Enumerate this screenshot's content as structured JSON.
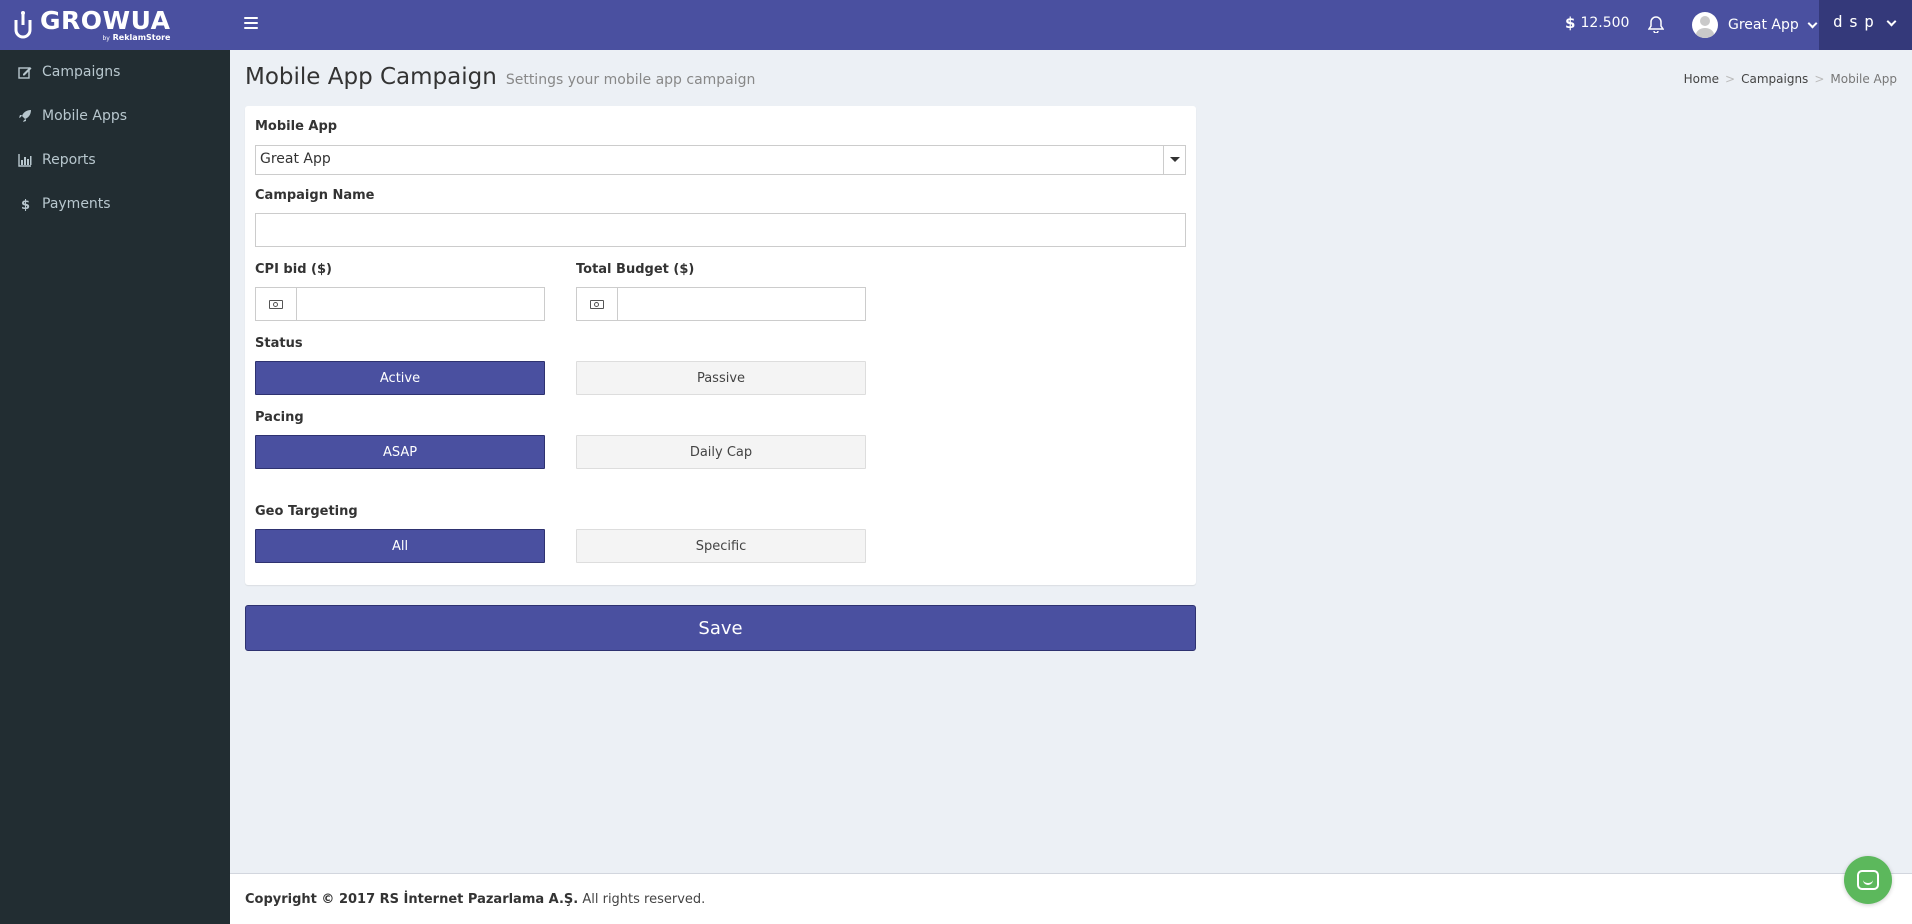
{
  "brand": {
    "title": "GROWUA",
    "sub_by": "by",
    "sub_name": "ReklamStore"
  },
  "header": {
    "balance_symbol": "$",
    "balance": "12.500",
    "user_name": "Great App",
    "dsp_label": "dsp"
  },
  "sidebar": {
    "items": [
      {
        "label": "Campaigns",
        "icon": "edit-icon"
      },
      {
        "label": "Mobile Apps",
        "icon": "rocket-icon"
      },
      {
        "label": "Reports",
        "icon": "bar-chart-icon"
      },
      {
        "label": "Payments",
        "icon": "dollar-icon"
      }
    ]
  },
  "page": {
    "title": "Mobile App Campaign",
    "subtitle": "Settings your mobile app campaign"
  },
  "breadcrumb": [
    "Home",
    "Campaigns",
    "Mobile App"
  ],
  "form": {
    "mobile_app_label": "Mobile App",
    "mobile_app_value": "Great App",
    "campaign_name_label": "Campaign Name",
    "campaign_name_value": "",
    "cpi_bid_label": "CPI bid ($)",
    "cpi_bid_value": "",
    "total_budget_label": "Total Budget ($)",
    "total_budget_value": "",
    "status_label": "Status",
    "status_active": "Active",
    "status_passive": "Passive",
    "pacing_label": "Pacing",
    "pacing_asap": "ASAP",
    "pacing_daily": "Daily Cap",
    "geo_label": "Geo Targeting",
    "geo_all": "All",
    "geo_specific": "Specific",
    "save_label": "Save"
  },
  "footer": {
    "copyright": "Copyright © 2017 RS İnternet Pazarlama A.Ş.",
    "rights": " All rights reserved."
  },
  "colors": {
    "primary": "#4a50a0",
    "sidebar": "#222d32",
    "background": "#ecf0f5",
    "chat": "#5cb85c"
  }
}
